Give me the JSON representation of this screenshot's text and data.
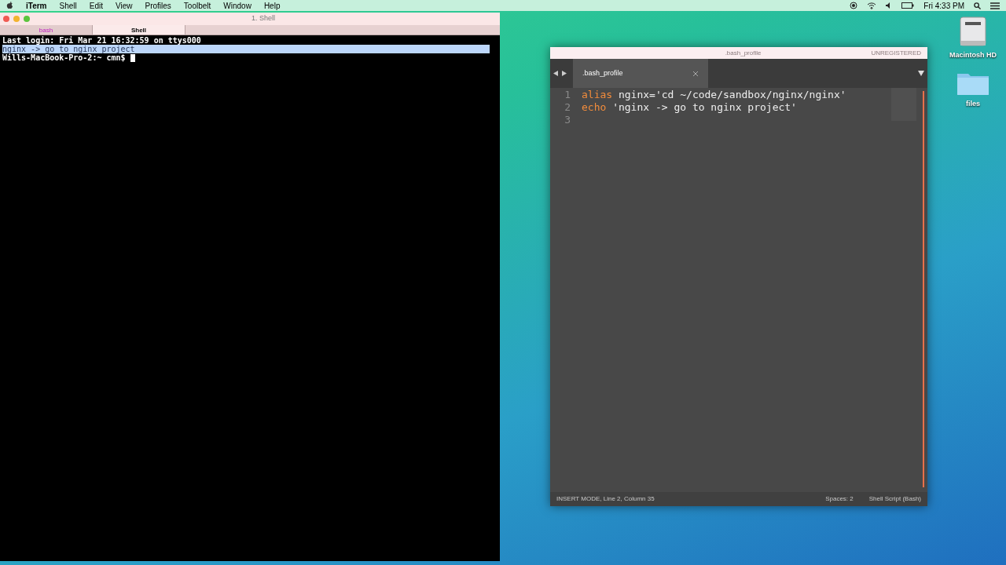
{
  "menu_bar": {
    "app_name": "iTerm",
    "items": [
      "Shell",
      "Edit",
      "View",
      "Profiles",
      "Toolbelt",
      "Window",
      "Help"
    ],
    "clock": "Fri 4:33 PM"
  },
  "terminal": {
    "title": "1. Shell",
    "tabs": [
      {
        "label": "bash",
        "selected": false
      },
      {
        "label": "Shell",
        "selected": true
      }
    ],
    "lines": [
      {
        "text": "Last login: Fri Mar 21 16:32:59 on ttys000",
        "highlighted": false
      },
      {
        "text": "nginx -> go to nginx project",
        "highlighted": true
      },
      {
        "text": "Wills-MacBook-Pro-2:~ cmn$",
        "highlighted": false
      }
    ]
  },
  "editor": {
    "title": ".bash_profile",
    "badge": "UNREGISTERED",
    "tab": ".bash_profile",
    "lines": [
      {
        "number": "1",
        "tokens": [
          {
            "text": "alias",
            "kind": "keyword"
          },
          {
            "text": " nginx='cd ~/code/sandbox/nginx/nginx'",
            "kind": "plain"
          }
        ]
      },
      {
        "number": "2",
        "tokens": [
          {
            "text": "echo",
            "kind": "keyword"
          },
          {
            "text": " 'nginx -> go to nginx project'",
            "kind": "plain"
          }
        ]
      },
      {
        "number": "3"
      }
    ],
    "status_left": "INSERT MODE, Line 2, Column 35",
    "status_right": [
      "Spaces: 2",
      "Shell Script (Bash)"
    ]
  },
  "desktop_icons": [
    {
      "label": "Macintosh HD",
      "kind": "drive"
    },
    {
      "label": "files",
      "kind": "folder"
    }
  ]
}
